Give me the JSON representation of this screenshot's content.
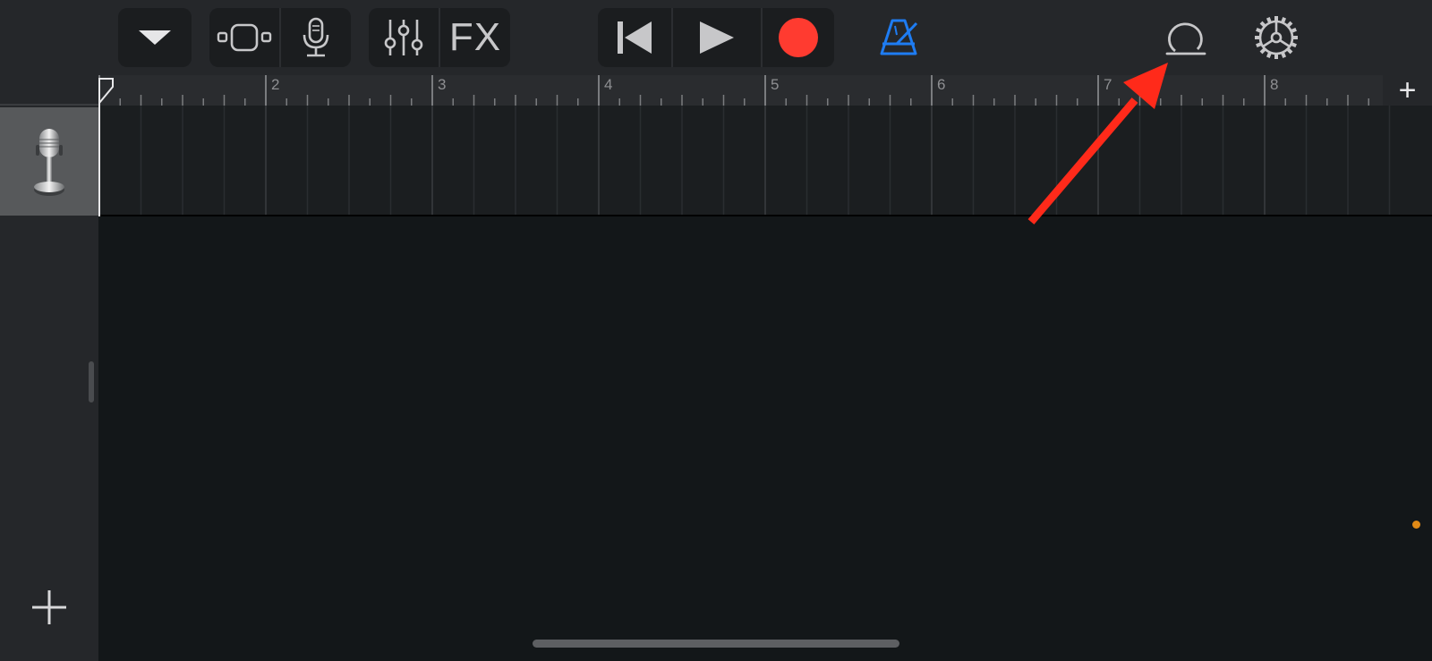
{
  "toolbar": {
    "browser_toggle": "chevron-down-icon",
    "view_toggle": "tracks-view-icon",
    "instrument": "microphone-icon",
    "mixer": "mixer-sliders-icon",
    "fx_label": "FX",
    "go_to_beginning": "skip-back-icon",
    "play": "play-icon",
    "record": "record-icon",
    "metronome": "metronome-icon",
    "loop_browser": "loop-icon",
    "settings": "gear-icon"
  },
  "ruler": {
    "bar_numbers": [
      "2",
      "3",
      "4",
      "5",
      "6",
      "7",
      "8"
    ],
    "add_section_label": "+"
  },
  "tracks": [
    {
      "instrument_icon": "studio-microphone-icon"
    }
  ],
  "sidebar": {
    "add_track_icon": "plus-icon"
  },
  "colors": {
    "toolbar_bg": "#25272a",
    "record_red": "#ff3b30",
    "metronome_blue": "#1e7cf2",
    "annotation_arrow": "#ff2a1a",
    "status_dot": "#e08a16"
  },
  "annotation": {
    "arrow_target": "loop-icon"
  }
}
